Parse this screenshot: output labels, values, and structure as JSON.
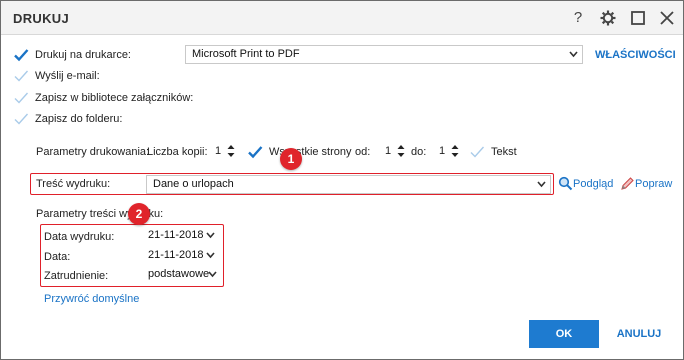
{
  "window": {
    "title": "DRUKUJ",
    "help_icon": "?",
    "settings_icon": "gear-icon",
    "maximize_icon": "square-icon",
    "close_icon": "close-icon"
  },
  "options": {
    "print_on_printer": {
      "label": "Drukuj na drukarce:",
      "checked": true
    },
    "send_email": {
      "label": "Wyślij e-mail:",
      "checked": false
    },
    "save_to_attachments": {
      "label": "Zapisz w bibliotece załączników:",
      "checked": false
    },
    "save_to_folder": {
      "label": "Zapisz do folderu:",
      "checked": false
    }
  },
  "printer": {
    "selected": "Microsoft Print to PDF",
    "properties_label": "WŁAŚCIWOŚCI"
  },
  "print_params": {
    "label": "Parametry drukowania:",
    "copies_label": "Liczba kopii:",
    "copies_value": "1",
    "all_pages_label": "Wszystkie strony",
    "all_pages_checked": true,
    "from_label": "od:",
    "from_value": "1",
    "to_label": "do:",
    "to_value": "1",
    "text_label": "Tekst",
    "text_checked": false
  },
  "content": {
    "label": "Treść wydruku:",
    "selected": "Dane o urlopach",
    "preview_label": "Podgląd",
    "edit_label": "Popraw"
  },
  "content_params": {
    "label": "Parametry treści wydruku:",
    "fields": [
      {
        "label": "Data wydruku:",
        "value": "21-11-2018"
      },
      {
        "label": "Data:",
        "value": "21-11-2018"
      },
      {
        "label": "Zatrudnienie:",
        "value": "podstawowe"
      }
    ],
    "restore_defaults": "Przywróć domyślne"
  },
  "markers": [
    "1",
    "2"
  ],
  "buttons": {
    "ok": "OK",
    "cancel": "ANULUJ"
  },
  "colors": {
    "accent": "#1e7bd0",
    "highlight": "#e0202a",
    "check": "#1a73c6"
  }
}
